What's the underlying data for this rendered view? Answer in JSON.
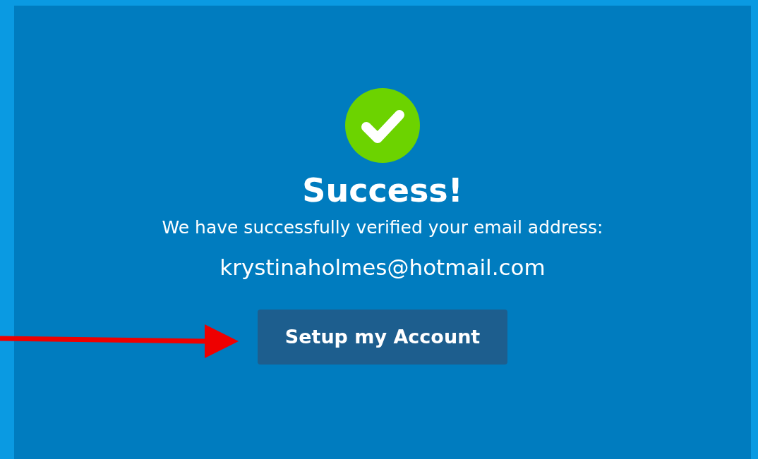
{
  "status": {
    "kind": "success"
  },
  "heading": "Success!",
  "message": "We have successfully verified your email address:",
  "email": "krystinaholmes@hotmail.com",
  "button": {
    "label": "Setup my Account"
  },
  "annotation": {
    "kind": "arrow"
  }
}
